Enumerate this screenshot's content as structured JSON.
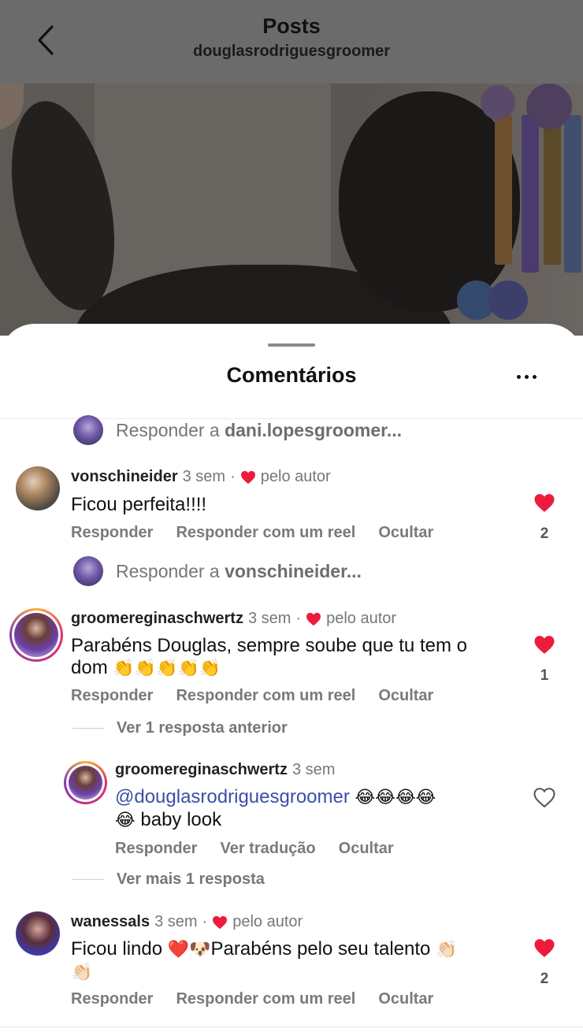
{
  "header": {
    "title": "Posts",
    "subtitle": "douglasrodriguesgroomer"
  },
  "sheet": {
    "title": "Comentários"
  },
  "colors": {
    "heart": "#ed1c3c",
    "mention": "#3b4fa8",
    "overlay": "#6b6b6b"
  },
  "icons": {
    "back": "chevron-left-icon",
    "more": "more-icon",
    "like_filled": "heart-filled-icon",
    "like_outline": "heart-outline-icon"
  },
  "reply_prompts": [
    {
      "prefix": "Responder a",
      "user": "dani.lopesgroomer..."
    },
    {
      "prefix": "Responder a",
      "user": "vonschineider..."
    }
  ],
  "comments": [
    {
      "user": "vonschineider",
      "time": "3 sem",
      "dot": "·",
      "author_badge": "pelo autor",
      "text": "Ficou perfeita!!!!",
      "actions": [
        "Responder",
        "Responder com um reel",
        "Ocultar"
      ],
      "likes": "2",
      "liked": true
    },
    {
      "user": "groomereginaschwertz",
      "time": "3 sem",
      "dot": "·",
      "author_badge": "pelo autor",
      "text_line1": "Parabéns Douglas, sempre soube que tu tem o",
      "text_line2": "dom",
      "emoji_line2": "👏👏👏👏👏",
      "actions": [
        "Responder",
        "Responder com um reel",
        "Ocultar"
      ],
      "likes": "1",
      "liked": true,
      "view_previous": "Ver 1 resposta anterior"
    },
    {
      "user": "groomereginaschwertz",
      "time": "3 sem",
      "mention": "@douglasrodriguesgroomer",
      "emoji_line1": "😂😂😂😂",
      "emoji_line2": "😂",
      "text_line2": "baby look",
      "actions": [
        "Responder",
        "Ver tradução",
        "Ocultar"
      ],
      "liked": false,
      "view_more": "Ver mais 1 resposta"
    },
    {
      "user": "wanessals",
      "time": "3 sem",
      "dot": "·",
      "author_badge": "pelo autor",
      "text_a": "Ficou lindo",
      "emoji_a": "❤️🐶",
      "text_b": "Parabéns pelo seu talento",
      "emoji_b": "👏🏻",
      "emoji_line2": "👏🏻",
      "actions": [
        "Responder",
        "Responder com um reel",
        "Ocultar"
      ],
      "likes": "2",
      "liked": true
    }
  ]
}
